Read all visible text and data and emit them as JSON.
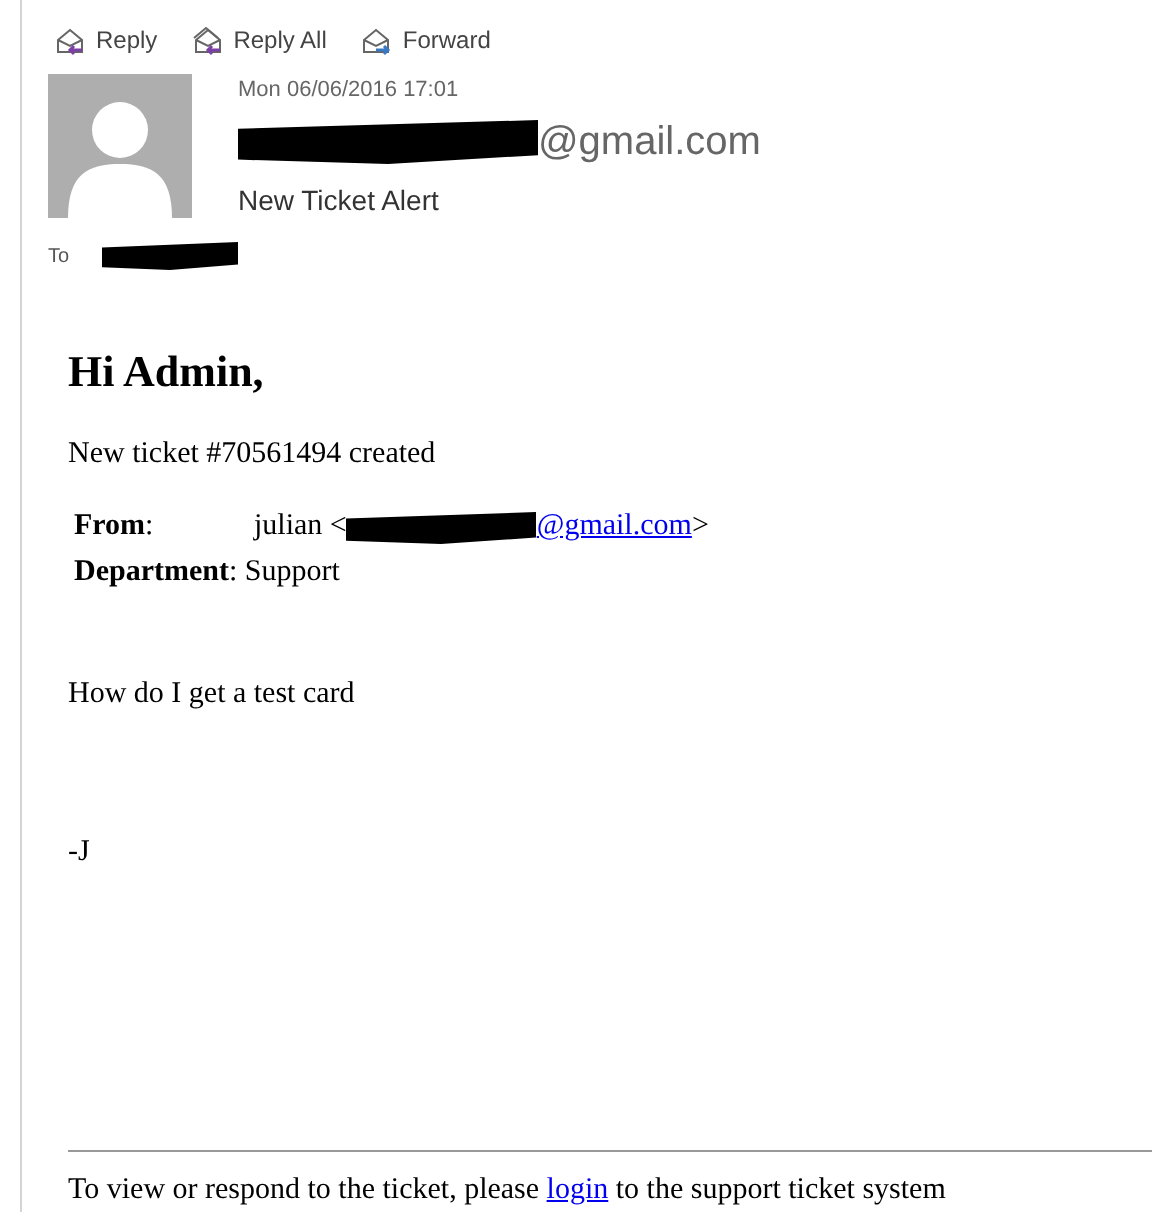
{
  "toolbar": [
    {
      "kind": "reply",
      "label": "Reply"
    },
    {
      "kind": "reply_all",
      "label": "Reply All"
    },
    {
      "kind": "forward",
      "label": "Forward"
    }
  ],
  "header": {
    "date": "Mon 06/06/2016 17:01",
    "sender_visible": "@gmail.com",
    "subject": "New Ticket Alert",
    "to_label": "To"
  },
  "body": {
    "greeting": "Hi Admin,",
    "intro": "New ticket #70561494 created",
    "fields": [
      {
        "label": "**From**:",
        "value_prefix": "julian <",
        "link": "@gmail.com",
        "value_suffix": ">"
      },
      {
        "label": "**Department**: Support"
      }
    ],
    "message": "How do I get a test card",
    "signature": "-J",
    "footer_before": "To view or respond to the ticket, please ",
    "footer_link": "login",
    "footer_after": " to the support ticket system"
  }
}
